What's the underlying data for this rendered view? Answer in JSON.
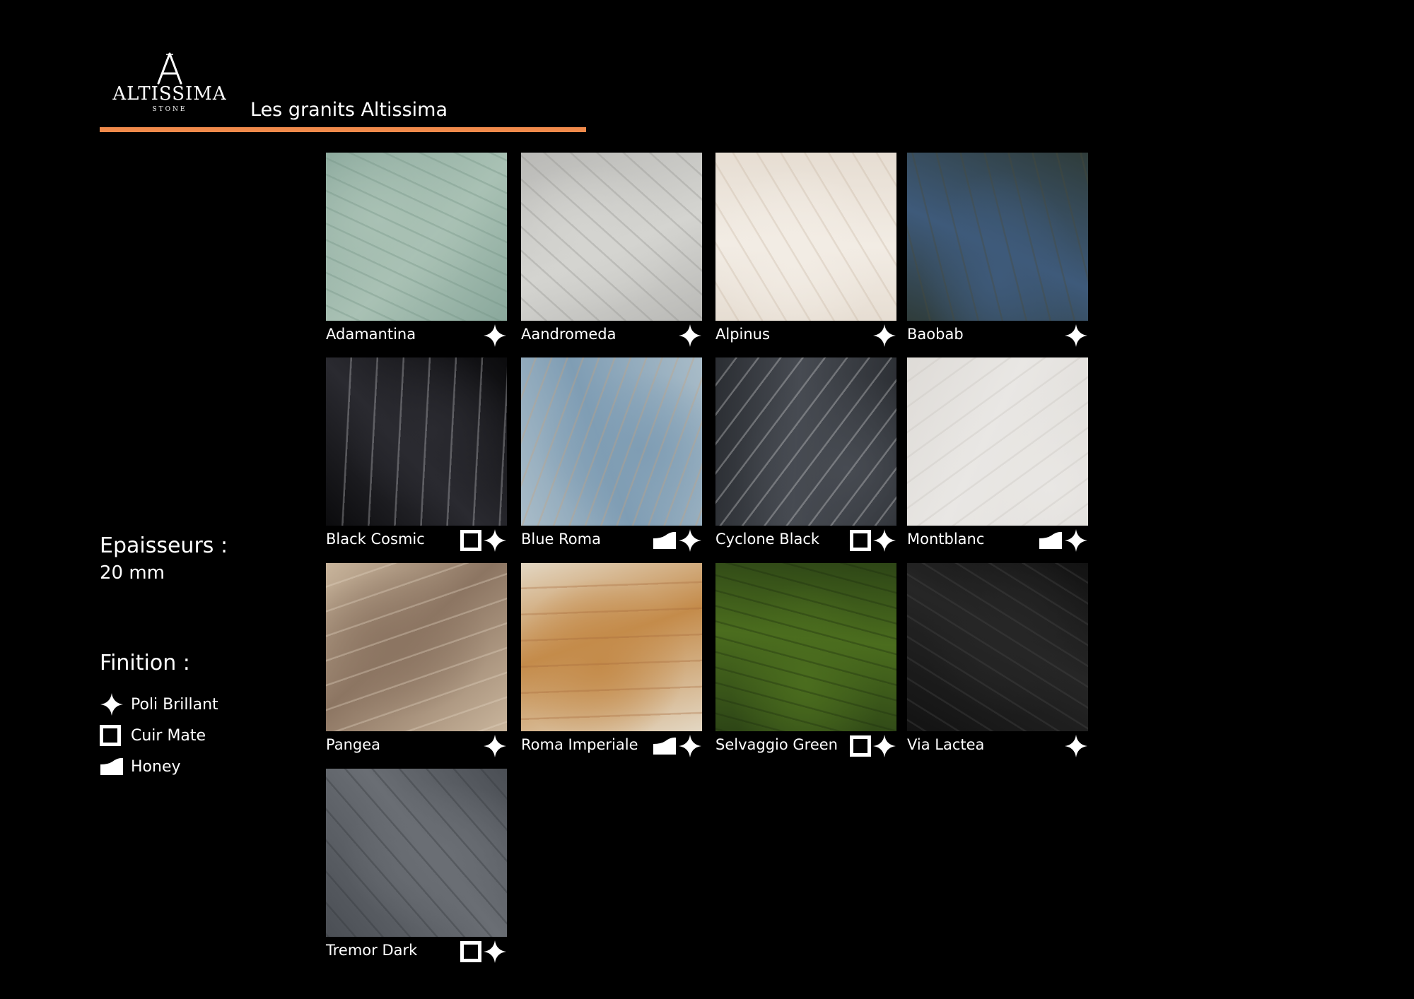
{
  "brand": {
    "name": "ALTISSIMA",
    "sub": "STONE",
    "accent": "#f08a4b"
  },
  "title": "Les granits Altissima",
  "thickness": {
    "heading": "Epaisseurs :",
    "value": "20 mm"
  },
  "finish": {
    "heading": "Finition :",
    "items": [
      {
        "icon": "sparkle-icon",
        "label": "Poli Brillant"
      },
      {
        "icon": "square-icon",
        "label": "Cuir Mate"
      },
      {
        "icon": "honey-icon",
        "label": "Honey"
      }
    ]
  },
  "stones": [
    {
      "name": "Adamantina",
      "finishes": [
        "star"
      ],
      "colors": [
        "#8aa89c",
        "#a9c1b4",
        "#6f8f80"
      ]
    },
    {
      "name": "Aandromeda",
      "finishes": [
        "star"
      ],
      "colors": [
        "#b9b9b6",
        "#d4d4d0",
        "#8e8e8a"
      ]
    },
    {
      "name": "Alpinus",
      "finishes": [
        "star"
      ],
      "colors": [
        "#e6ddd2",
        "#f2ece4",
        "#c6b4a0"
      ]
    },
    {
      "name": "Baobab",
      "finishes": [
        "star"
      ],
      "colors": [
        "#2f3c3a",
        "#3e5a7a",
        "#4b4a36"
      ]
    },
    {
      "name": "Black Cosmic",
      "finishes": [
        "box",
        "star"
      ],
      "colors": [
        "#0b0b0d",
        "#2a2a30",
        "#cfcfd2"
      ]
    },
    {
      "name": "Blue Roma",
      "finishes": [
        "honey",
        "star"
      ],
      "colors": [
        "#a9bcc8",
        "#7f9db4",
        "#c9a27a"
      ]
    },
    {
      "name": "Cyclone Black",
      "finishes": [
        "box",
        "star"
      ],
      "colors": [
        "#2b2e33",
        "#474b52",
        "#dcdcdc"
      ]
    },
    {
      "name": "Montblanc",
      "finishes": [
        "honey",
        "star"
      ],
      "colors": [
        "#dedbd7",
        "#e9e7e4",
        "#c6c2bc"
      ]
    },
    {
      "name": "Pangea",
      "finishes": [
        "star"
      ],
      "colors": [
        "#c9b59c",
        "#8c7562",
        "#e7d9c6"
      ]
    },
    {
      "name": "Roma Imperiale",
      "finishes": [
        "honey",
        "star"
      ],
      "colors": [
        "#e3d7c3",
        "#c48b4a",
        "#a5683a"
      ]
    },
    {
      "name": "Selvaggio Green",
      "finishes": [
        "box",
        "star"
      ],
      "colors": [
        "#2d4516",
        "#4b6d1e",
        "#1a2a0c"
      ]
    },
    {
      "name": "Via Lactea",
      "finishes": [
        "star"
      ],
      "colors": [
        "#121212",
        "#262626",
        "#4a4a4a"
      ]
    },
    {
      "name": "Tremor Dark",
      "finishes": [
        "box",
        "star"
      ],
      "colors": [
        "#4a4e54",
        "#6a6e74",
        "#2e3236"
      ]
    }
  ]
}
